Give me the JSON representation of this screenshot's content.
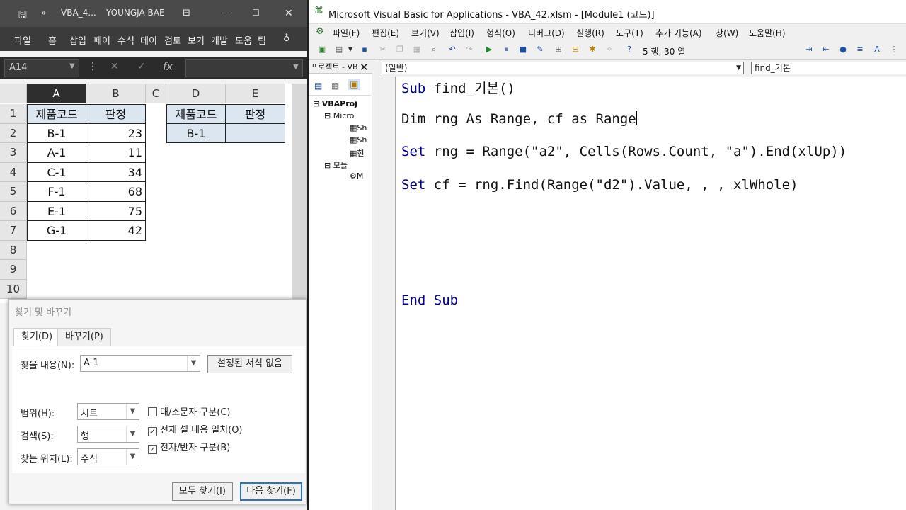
{
  "excel": {
    "title_file": "VBA_4...",
    "title_user": "YOUNGJA BAE",
    "ribbon_tabs": [
      "파일",
      "홈",
      "삽입",
      "페이",
      "수식",
      "데이",
      "검토",
      "보기",
      "개발",
      "도움",
      "팀"
    ],
    "namebox": "A14",
    "columns": [
      "A",
      "B",
      "C",
      "D",
      "E"
    ],
    "rows": [
      "1",
      "2",
      "3",
      "4",
      "5",
      "6",
      "7",
      "8",
      "9",
      "10"
    ],
    "table_left": {
      "headers": [
        "제품코드",
        "판정"
      ],
      "rows": [
        [
          "B-1",
          "23"
        ],
        [
          "A-1",
          "11"
        ],
        [
          "C-1",
          "34"
        ],
        [
          "F-1",
          "68"
        ],
        [
          "E-1",
          "75"
        ],
        [
          "G-1",
          "42"
        ]
      ]
    },
    "table_right": {
      "headers": [
        "제품코드",
        "판정"
      ],
      "row": [
        "B-1",
        ""
      ]
    }
  },
  "find_dialog": {
    "title": "찾기 및 바꾸기",
    "tabs": [
      "찾기(D)",
      "바꾸기(P)"
    ],
    "find_label": "찾을 내용(N):",
    "find_value": "A-1",
    "format_button": "설정된 서식 없음",
    "scope_label": "범위(H):",
    "scope_value": "시트",
    "search_label": "검색(S):",
    "search_value": "행",
    "lookin_label": "찾는 위치(L):",
    "lookin_value": "수식",
    "opt_case": "대/소문자 구분(C)",
    "opt_whole": "전체 셀 내용 일치(O)",
    "opt_width": "전자/반자 구분(B)",
    "find_all": "모두 찾기(I)",
    "find_next": "다음 찾기(F)"
  },
  "vbe": {
    "title": "Microsoft Visual Basic for Applications - VBA_42.xlsm - [Module1 (코드)]",
    "menu": [
      "파일(F)",
      "편집(E)",
      "보기(V)",
      "삽입(I)",
      "형식(O)",
      "디버그(D)",
      "실행(R)",
      "도구(T)",
      "추가 기능(A)",
      "창(W)",
      "도움말(H)"
    ],
    "position": "5 행, 30 열",
    "project_title": "프로젝트 - VB",
    "project_tree": [
      "VBAProj",
      "Micro",
      "Sh",
      "Sh",
      "현",
      "모듈",
      "M"
    ],
    "combo_object": "(일반)",
    "combo_proc": "find_기본",
    "code": {
      "l1_kw": "Sub",
      "l1_rest": " find_기본()",
      "l2_kw": "Dim",
      "l2_rest": " rng As Range, cf as Range",
      "l3_kw": "Set",
      "l3_rest": " rng = Range(\"a2\", Cells(Rows.Count, \"a\").End(xlUp))",
      "l4_kw": "Set",
      "l4_rest": " cf = rng.Find(Range(\"d2\").Value, , , xlWhole)",
      "l5_kw": "End Sub"
    }
  }
}
